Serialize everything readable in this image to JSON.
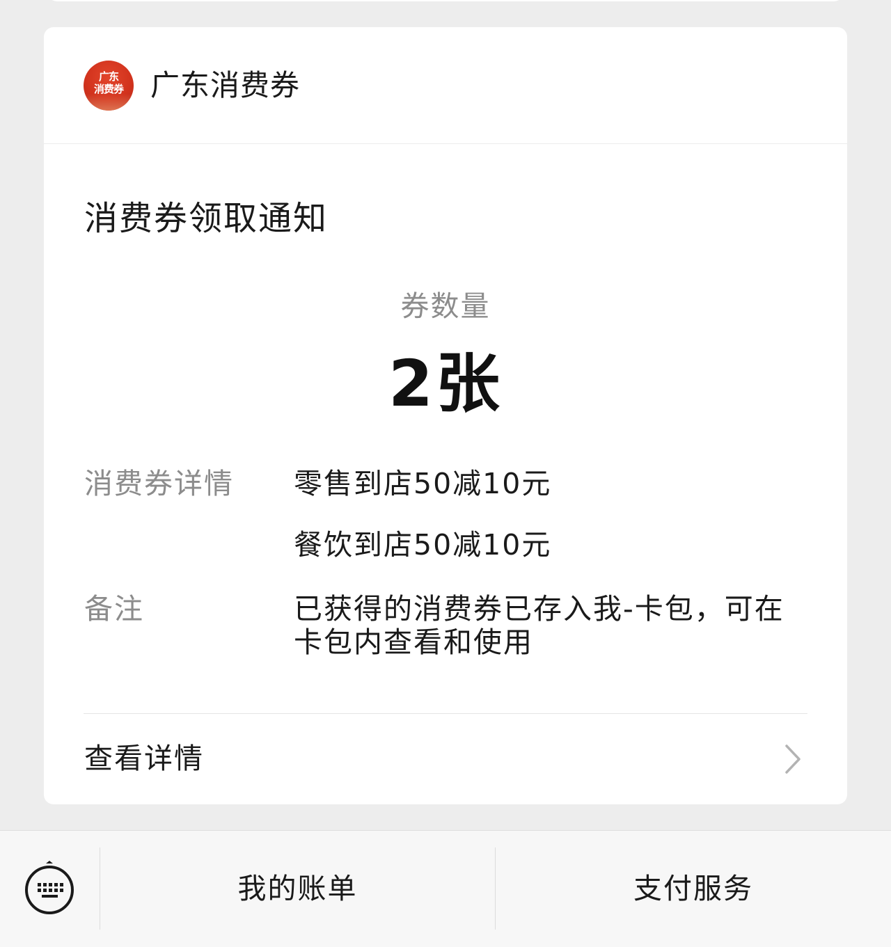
{
  "header": {
    "logo_line1": "广东",
    "logo_line2": "消费券",
    "brand_name": "广东消费券"
  },
  "notice": {
    "title": "消费券领取通知",
    "quantity_label": "券数量",
    "quantity_value": "2张",
    "details_label": "消费券详情",
    "details": [
      "零售到店50减10元",
      "餐饮到店50减10元"
    ],
    "remark_label": "备注",
    "remark_value": "已获得的消费券已存入我-卡包，可在卡包内查看和使用",
    "view_details": "查看详情"
  },
  "bottom_menu": {
    "items": [
      {
        "label": "我的账单"
      },
      {
        "label": "支付服务"
      }
    ]
  },
  "icons": {
    "keyboard": "keyboard-icon",
    "chevron": "chevron-right-icon"
  },
  "colors": {
    "background": "#ededed",
    "card": "#ffffff",
    "logo_red": "#d2331d",
    "text_primary": "#1a1a1a",
    "text_secondary": "#8c8c8c",
    "bottom_bar": "#f7f7f7"
  }
}
